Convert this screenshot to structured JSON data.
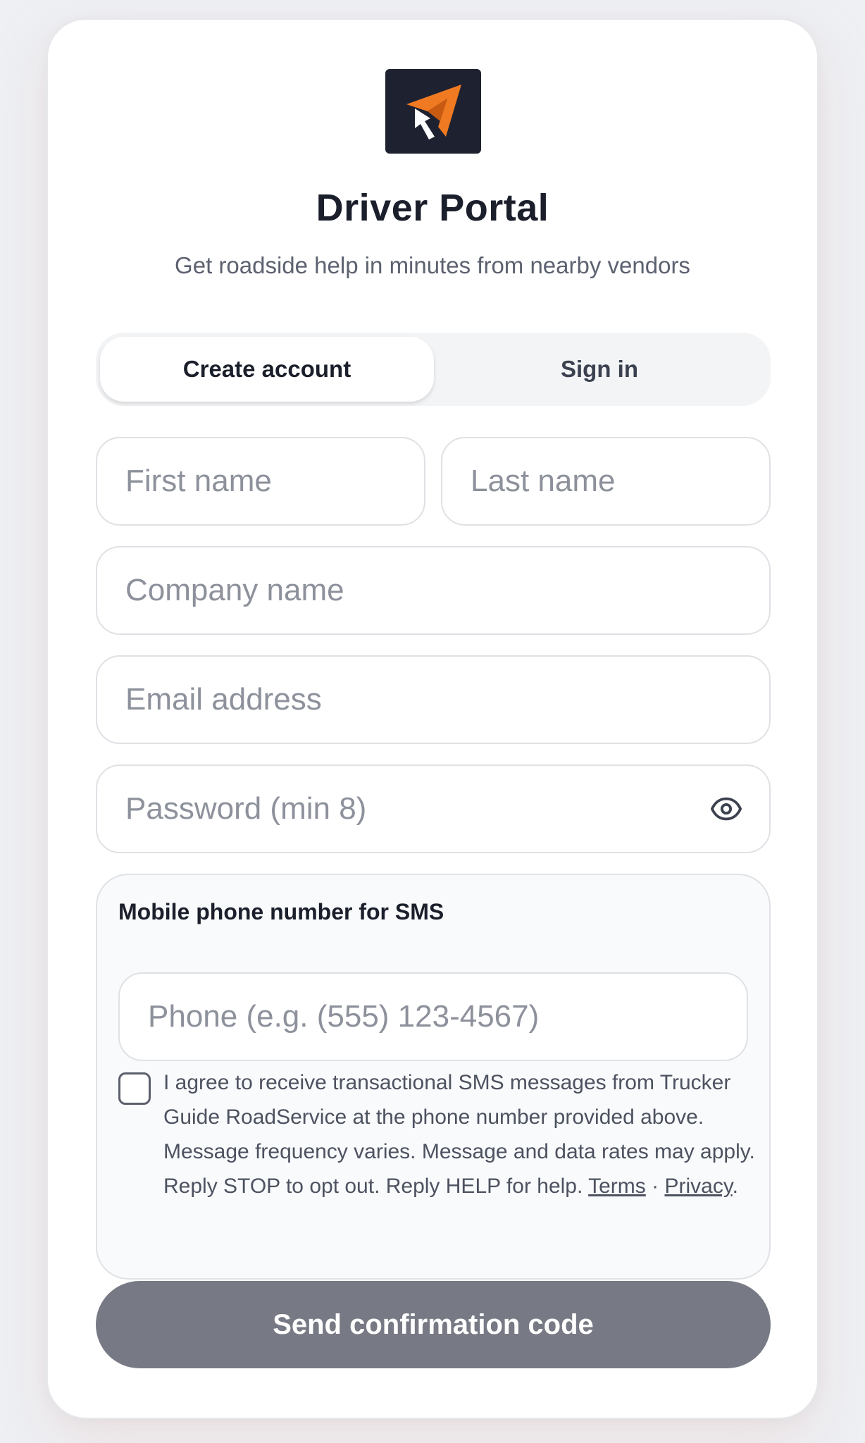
{
  "header": {
    "logo_icon": "arrow-logo-icon",
    "title": "Driver Portal",
    "subtitle": "Get roadside help in minutes from nearby vendors"
  },
  "tabs": [
    {
      "label": "Create account",
      "active": true
    },
    {
      "label": "Sign in",
      "active": false
    }
  ],
  "form": {
    "first_name": {
      "placeholder": "First name",
      "value": ""
    },
    "last_name": {
      "placeholder": "Last name",
      "value": ""
    },
    "company": {
      "placeholder": "Company name",
      "value": ""
    },
    "email": {
      "placeholder": "Email address",
      "value": ""
    },
    "password": {
      "placeholder": "Password (min 8)",
      "value": "",
      "toggle_icon": "eye-icon"
    }
  },
  "sms": {
    "label": "Mobile phone number for SMS",
    "phone": {
      "placeholder": "Phone (e.g. (555) 123-4567)",
      "value": ""
    },
    "consent_checked": false,
    "consent_text": "I agree to receive transactional SMS messages from Trucker Guide RoadService at the phone number provided above. Message frequency varies. Message and data rates may apply. Reply STOP to opt out. Reply HELP for help.",
    "terms_label": "Terms",
    "separator": "·",
    "privacy_label": "Privacy",
    "end_punct": "."
  },
  "submit": {
    "label": "Send confirmation code"
  },
  "colors": {
    "accent": "#f07a22",
    "logo_bg": "#1e2230",
    "button_disabled": "#777a84"
  }
}
